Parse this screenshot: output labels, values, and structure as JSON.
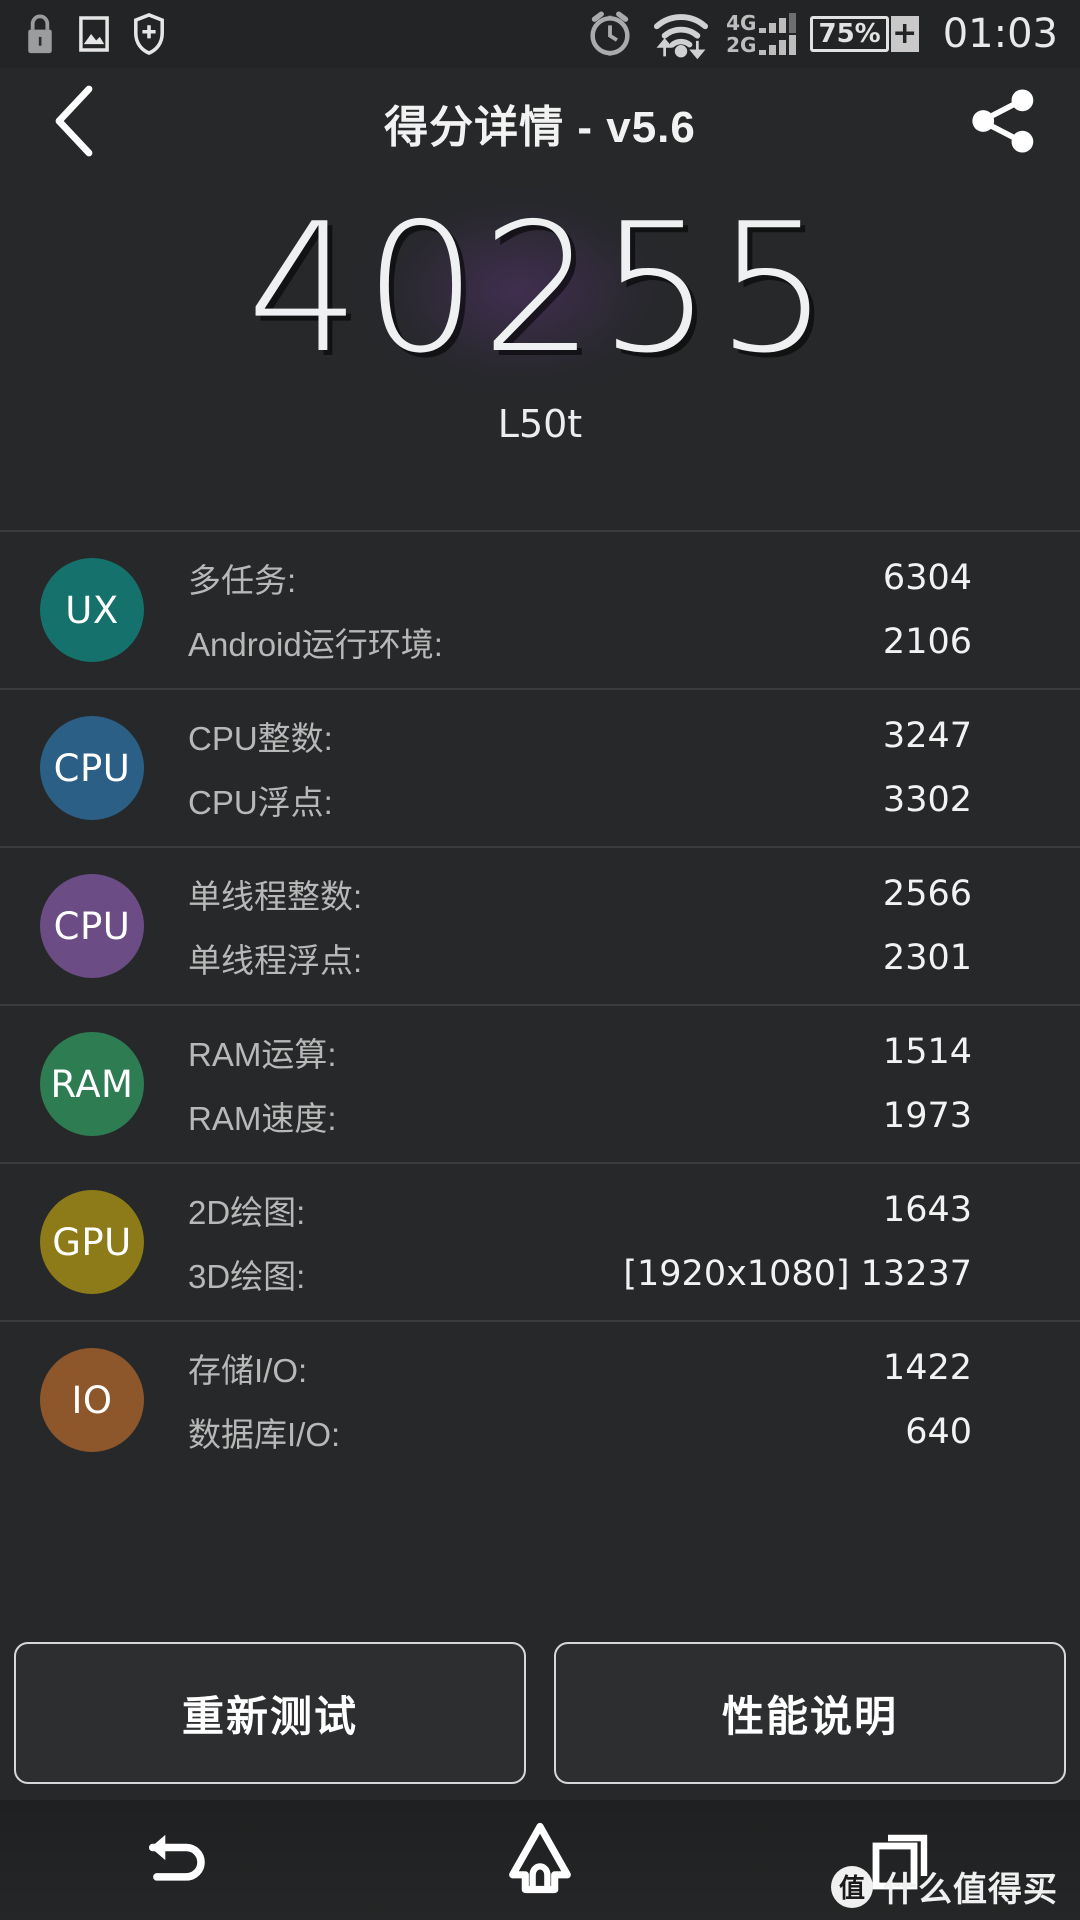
{
  "status_bar": {
    "left_icons": [
      "lock-icon",
      "image-icon",
      "shield-plus-icon"
    ],
    "alarm_icon": "alarm-clock-icon",
    "wifi_icon": "wifi-transfer-icon",
    "network_rows": [
      {
        "label": "4G"
      },
      {
        "label": "2G"
      }
    ],
    "battery_percent": "75%",
    "battery_charge_symbol": "+",
    "clock": "01:03"
  },
  "appbar": {
    "back_icon": "chevron-left-icon",
    "title": "得分详情 - v5.6",
    "share_icon": "share-nodes-icon"
  },
  "hero": {
    "score": "40255",
    "device_name": "L50t"
  },
  "groups": [
    {
      "badge": "UX",
      "color": "#14716b",
      "rows": [
        {
          "label": "多任务:",
          "value": "6304"
        },
        {
          "label": "Android运行环境:",
          "value": "2106"
        }
      ]
    },
    {
      "badge": "CPU",
      "color": "#2b5f86",
      "rows": [
        {
          "label": "CPU整数:",
          "value": "3247"
        },
        {
          "label": "CPU浮点:",
          "value": "3302"
        }
      ]
    },
    {
      "badge": "CPU",
      "color": "#6c4c84",
      "rows": [
        {
          "label": "单线程整数:",
          "value": "2566"
        },
        {
          "label": "单线程浮点:",
          "value": "2301"
        }
      ]
    },
    {
      "badge": "RAM",
      "color": "#2e7d52",
      "rows": [
        {
          "label": "RAM运算:",
          "value": "1514"
        },
        {
          "label": "RAM速度:",
          "value": "1973"
        }
      ]
    },
    {
      "badge": "GPU",
      "color": "#8d7a18",
      "rows": [
        {
          "label": "2D绘图:",
          "value": "1643"
        },
        {
          "label": "3D绘图:",
          "value": "[1920x1080] 13237"
        }
      ]
    },
    {
      "badge": "IO",
      "color": "#8d572b",
      "rows": [
        {
          "label": "存储I/O:",
          "value": "1422"
        },
        {
          "label": "数据库I/O:",
          "value": "640"
        }
      ]
    }
  ],
  "actions": {
    "retest_label": "重新测试",
    "performance_label": "性能说明"
  },
  "navbar": {
    "back_icon": "nav-back-icon",
    "home_icon": "nav-home-icon",
    "recents_icon": "nav-recents-icon"
  },
  "watermark": {
    "mark": "值",
    "text": "什么值得买"
  }
}
